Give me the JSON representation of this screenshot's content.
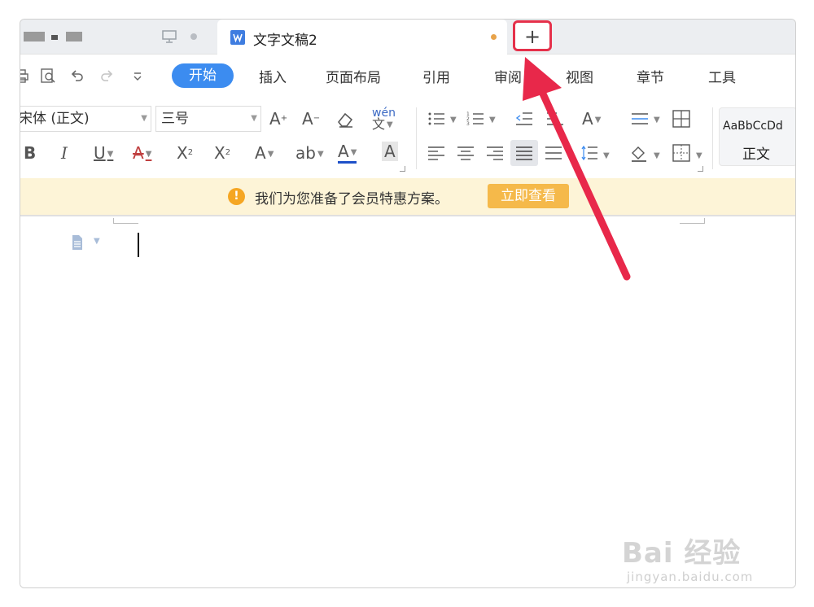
{
  "tabs": {
    "active_title": "文字文稿2",
    "new_tab_label": "+"
  },
  "menu": {
    "items": [
      "开始",
      "插入",
      "页面布局",
      "引用",
      "审阅",
      "视图",
      "章节",
      "工具"
    ]
  },
  "toolbar": {
    "font_name": "宋体 (正文)",
    "font_size": "三号",
    "pinyin_glyph": "wén 文",
    "style_sample": "AaBbCcDd",
    "style_name": "正文"
  },
  "notice": {
    "text": "我们为您准备了会员特惠方案。",
    "button": "立即查看",
    "icon": "!"
  },
  "watermark": {
    "main": "Bai 经验",
    "sub": "jingyan.baidu.com"
  },
  "colors": {
    "accent": "#3c8cf0",
    "highlight_box": "#e5304a",
    "notice_bg": "#fdf4d7",
    "notice_button": "#f5b94a"
  }
}
